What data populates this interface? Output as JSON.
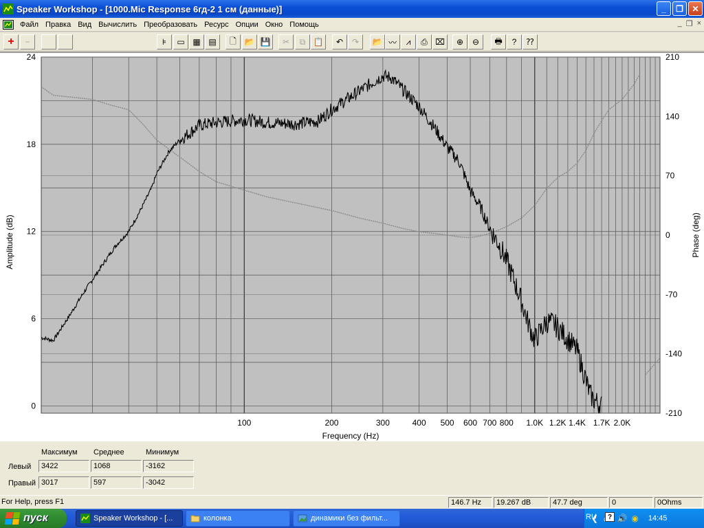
{
  "window": {
    "title": "Speaker Workshop - [1000.Mic Response 6гд-2 1 см (данные)]",
    "controls": {
      "minimize": "_",
      "restore": "❐",
      "close": "✕"
    }
  },
  "menu": {
    "items": [
      "Файл",
      "Правка",
      "Вид",
      "Вычислить",
      "Преобразовать",
      "Ресурс",
      "Опции",
      "Окно",
      "Помощь"
    ],
    "mdi_controls": {
      "minimize": "_",
      "restore": "❐",
      "close": "×"
    }
  },
  "toolbar": {
    "buttons": [
      {
        "name": "add-icon",
        "glyph": "+",
        "color": "#e00000",
        "enabled": true
      },
      {
        "name": "remove-icon",
        "glyph": "−",
        "color": "#a0a0a0",
        "enabled": false
      },
      {
        "name": "blank-1-icon",
        "glyph": "",
        "enabled": false
      },
      {
        "name": "blank-2-icon",
        "glyph": "",
        "enabled": false
      },
      {
        "name": "align-icon",
        "glyph": "⊧",
        "enabled": true
      },
      {
        "name": "view-1-icon",
        "glyph": "▭",
        "enabled": true
      },
      {
        "name": "view-2-icon",
        "glyph": "▦",
        "enabled": true
      },
      {
        "name": "view-3-icon",
        "glyph": "▤",
        "enabled": true
      },
      {
        "name": "new-file-icon",
        "glyph": "🗋",
        "enabled": true
      },
      {
        "name": "open-folder-icon",
        "glyph": "📂",
        "enabled": true
      },
      {
        "name": "save-icon",
        "glyph": "💾",
        "enabled": true
      },
      {
        "name": "cut-icon",
        "glyph": "✂",
        "enabled": false
      },
      {
        "name": "copy-icon",
        "glyph": "⧉",
        "enabled": false
      },
      {
        "name": "paste-icon",
        "glyph": "📋",
        "enabled": false
      },
      {
        "name": "undo-icon",
        "glyph": "↶",
        "enabled": true
      },
      {
        "name": "redo-icon",
        "glyph": "↷",
        "enabled": false
      },
      {
        "name": "open-doc-icon",
        "glyph": "📂",
        "enabled": false
      },
      {
        "name": "chart-1-icon",
        "glyph": "〰",
        "enabled": true
      },
      {
        "name": "chart-2-icon",
        "glyph": "⩘",
        "enabled": true
      },
      {
        "name": "export-icon",
        "glyph": "⎙",
        "enabled": true
      },
      {
        "name": "delete-chart-icon",
        "glyph": "⌧",
        "enabled": true
      },
      {
        "name": "zoom-in-icon",
        "glyph": "⊕",
        "enabled": true
      },
      {
        "name": "zoom-out-icon",
        "glyph": "⊖",
        "enabled": true
      },
      {
        "name": "print-icon",
        "glyph": "🖶",
        "enabled": true
      },
      {
        "name": "help-icon",
        "glyph": "?",
        "enabled": true
      },
      {
        "name": "context-help-icon",
        "glyph": "⁇",
        "enabled": true
      }
    ]
  },
  "chart_data": {
    "type": "line",
    "xlabel": "Frequency (Hz)",
    "ylabel": "Amplitude (dB)",
    "y2label": "Phase (deg)",
    "xscale": "log",
    "xlim": [
      20,
      2700
    ],
    "ylim": [
      -0.5,
      24
    ],
    "y2lim": [
      -210,
      210
    ],
    "xticks": [
      {
        "value": 100,
        "label": "100"
      },
      {
        "value": 200,
        "label": "200"
      },
      {
        "value": 300,
        "label": "300"
      },
      {
        "value": 400,
        "label": "400"
      },
      {
        "value": 500,
        "label": "500"
      },
      {
        "value": 600,
        "label": "600"
      },
      {
        "value": 700,
        "label": "700"
      },
      {
        "value": 800,
        "label": "800"
      },
      {
        "value": 1000,
        "label": "1.0K"
      },
      {
        "value": 1200,
        "label": "1.2K"
      },
      {
        "value": 1400,
        "label": "1.4K"
      },
      {
        "value": 1700,
        "label": "1.7K"
      },
      {
        "value": 2000,
        "label": "2.0K"
      }
    ],
    "yticks": [
      0,
      6,
      12,
      18,
      24
    ],
    "y2ticks": [
      -210,
      -140,
      -70,
      0,
      70,
      140,
      210
    ],
    "grid": true,
    "background": "#c0c0c0",
    "series": [
      {
        "role": "amplitude",
        "color": "#000000",
        "x": [
          20,
          22,
          25,
          28,
          32,
          36,
          40,
          44,
          48,
          50,
          55,
          60,
          65,
          70,
          80,
          90,
          100,
          120,
          150,
          180,
          200,
          230,
          260,
          300,
          320,
          350,
          400,
          450,
          500,
          550,
          600,
          650,
          700,
          750,
          800,
          850,
          900,
          950,
          1000,
          1050,
          1100,
          1150,
          1200,
          1300,
          1400,
          1500,
          1550,
          1600,
          1700
        ],
        "y": [
          4.7,
          4.5,
          6.2,
          7.8,
          9.5,
          11.0,
          12.0,
          13.5,
          15.0,
          16.0,
          17.5,
          18.3,
          18.8,
          19.3,
          19.5,
          19.6,
          19.7,
          19.5,
          19.4,
          19.6,
          20.4,
          21.2,
          21.9,
          22.7,
          22.6,
          21.8,
          20.6,
          19.2,
          17.8,
          16.8,
          14.8,
          13.7,
          12.2,
          11.2,
          10.0,
          8.6,
          7.2,
          5.7,
          4.5,
          5.2,
          5.8,
          5.7,
          5.4,
          4.6,
          3.8,
          1.8,
          0.8,
          0.4,
          0.0
        ]
      },
      {
        "role": "phase",
        "color": "#8a8a8a",
        "x": [
          20,
          22,
          25,
          30,
          35,
          40,
          45,
          50,
          60,
          70,
          80,
          100,
          120,
          150,
          200,
          250,
          300,
          350,
          400,
          450,
          500,
          550,
          600,
          650,
          700,
          750,
          800,
          900,
          1000,
          1100,
          1200,
          1300,
          1400,
          1500,
          1600,
          1700,
          1800,
          2000,
          2200,
          2300,
          2400,
          2700
        ],
        "y": [
          175,
          165,
          163,
          160,
          153,
          148,
          130,
          112,
          92,
          75,
          63,
          53,
          45,
          38,
          29,
          20,
          14,
          8,
          4,
          2,
          0,
          -2,
          -3,
          -1,
          2,
          6,
          10,
          20,
          35,
          55,
          68,
          75,
          85,
          100,
          120,
          135,
          148,
          160,
          178,
          190,
          -165,
          -145
        ]
      }
    ]
  },
  "stats": {
    "headers": [
      "Максимум",
      "Среднее",
      "Минимум"
    ],
    "rows": [
      {
        "label": "Левый",
        "values": [
          "3422",
          "1068",
          "-3162"
        ]
      },
      {
        "label": "Правый",
        "values": [
          "3017",
          "597",
          "-3042"
        ]
      }
    ]
  },
  "status": {
    "help": "For Help, press F1",
    "freq": "146.7 Hz",
    "amp": "19.267 dB",
    "phase": "47.7 deg",
    "val": "0",
    "imp": "0Ohms"
  },
  "taskbar": {
    "start": "пуск",
    "tasks": [
      {
        "label": "Speaker Workshop - [...",
        "active": true
      },
      {
        "label": "колонка",
        "active": false
      },
      {
        "label": "динамики без фильт...",
        "active": false
      }
    ],
    "lang": "RU",
    "time": "14:45"
  }
}
